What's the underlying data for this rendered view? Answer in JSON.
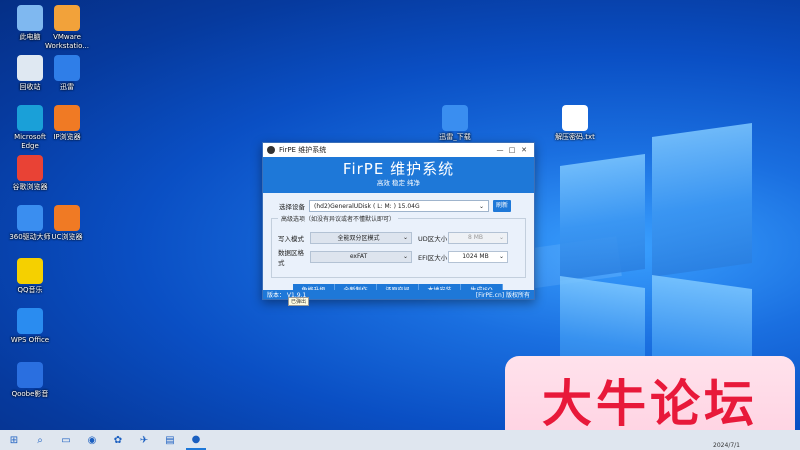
{
  "desktop": {
    "icons_left": [
      {
        "label": "此电脑",
        "icon": "computer-icon",
        "color": "#7fb8f0"
      },
      {
        "label": "VMware Workstatio...",
        "icon": "vmware-icon",
        "color": "#f2a23a"
      },
      {
        "label": "回收站",
        "icon": "recycle-bin-icon",
        "color": "#dfe8f2"
      },
      {
        "label": "迅雷",
        "icon": "xunlei-icon",
        "color": "#2f7ee8"
      },
      {
        "label": "Microsoft Edge",
        "icon": "edge-icon",
        "color": "#1aa0d8"
      },
      {
        "label": "IP浏览器",
        "icon": "ip-browser-icon",
        "color": "#f07a24"
      },
      {
        "label": "谷歌浏览器",
        "icon": "chrome-icon",
        "color": "#e94235"
      },
      {
        "label": "360驱动大师",
        "icon": "driver-icon",
        "color": "#3a8ef0"
      },
      {
        "label": "UC浏览器",
        "icon": "uc-browser-icon",
        "color": "#f07a24"
      },
      {
        "label": "QQ音乐",
        "icon": "qq-music-icon",
        "color": "#f5d000"
      },
      {
        "label": "WPS Office",
        "icon": "wps-icon",
        "color": "#2a8cf0"
      },
      {
        "label": "Qoobe影音",
        "icon": "media-icon",
        "color": "#2a6fe0"
      }
    ],
    "icons_right": [
      {
        "label": "迅雷_下载",
        "icon": "xunlei-download-icon",
        "color": "#3a8ef0"
      },
      {
        "label": "解压密码.txt",
        "icon": "text-file-icon",
        "color": "#ffffff"
      }
    ]
  },
  "window": {
    "title": "FirPE 维护系统",
    "minimize": "—",
    "maximize": "□",
    "close": "✕",
    "banner_title": "FirPE 维护系统",
    "banner_subtitle": "高效 稳定 纯净",
    "device_label": "选择设备",
    "device_value": "(hd2)GeneralUDisk ( L: M: ) 15.04G",
    "refresh_label": "刷新",
    "advanced_legend": "高级选项（如没有异议或者不懂默认即可）",
    "write_mode_label": "写入模式",
    "write_mode_value": "全能双分区模式",
    "ud_size_label": "UD区大小",
    "ud_size_value": "8 MB",
    "data_format_label": "数据区格式",
    "data_format_value": "exFAT",
    "efi_size_label": "EFI区大小",
    "efi_size_value": "1024 MB",
    "actions": [
      "免格升级",
      "全新制作",
      "还原空间",
      "本地安装",
      "生成ISO"
    ],
    "version_text": "版本： V1.9.1",
    "site_text": "[FirPE.cn]  版权所有",
    "tooltip": "已弹出"
  },
  "watermark": "大牛论坛",
  "taskbar": {
    "items": [
      {
        "icon": "start-icon",
        "glyph": "⊞"
      },
      {
        "icon": "search-icon",
        "glyph": "⌕"
      },
      {
        "icon": "file-explorer-icon",
        "glyph": "▭"
      },
      {
        "icon": "edge-icon",
        "glyph": "◉"
      },
      {
        "icon": "settings-icon",
        "glyph": "✿"
      },
      {
        "icon": "xunlei-icon",
        "glyph": "✈"
      },
      {
        "icon": "notepad-icon",
        "glyph": "▤"
      },
      {
        "icon": "firpe-icon",
        "glyph": "●"
      }
    ],
    "clock": "2024/7/1"
  },
  "colors": {
    "accent": "#1e78d8",
    "watermark": "#e8193a"
  }
}
